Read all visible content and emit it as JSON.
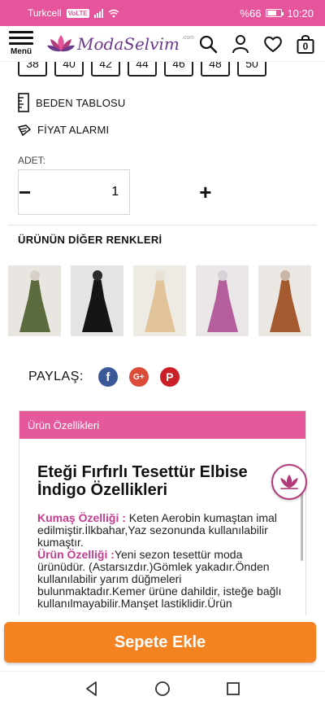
{
  "status_bar": {
    "carrier": "Turkcell",
    "network_badge": "VoLTE",
    "battery_percent": "%66",
    "time": "10:20",
    "color": "#e6559b"
  },
  "header": {
    "menu_label": "Menü",
    "logo_text": "ModaSelvim",
    "logo_sub": ".com",
    "icons": [
      "search-icon",
      "user-icon",
      "heart-icon",
      "cart-icon"
    ],
    "cart_count": "0"
  },
  "sizes": [
    "38",
    "40",
    "42",
    "44",
    "46",
    "48",
    "50"
  ],
  "links": {
    "size_chart": "BEDEN TABLOSU",
    "price_alarm": "FİYAT ALARMI"
  },
  "quantity": {
    "label": "ADET:",
    "minus": "−",
    "value": "1",
    "plus": "+"
  },
  "other_colors": {
    "title": "ÜRÜNÜN DİĞER RENKLERİ",
    "items": [
      {
        "name": "Haki",
        "dress": "#5b6b3e",
        "bg": "#e9e6e1",
        "head": "#d8cfc7"
      },
      {
        "name": "Siyah",
        "dress": "#151515",
        "bg": "#e6e4e2",
        "head": "#2a2a2a"
      },
      {
        "name": "Bej",
        "dress": "#e2c49a",
        "bg": "#eeeae4",
        "head": "#e9e0d4"
      },
      {
        "name": "Lila",
        "dress": "#b45f9c",
        "bg": "#ebe7e9",
        "head": "#d9d1d9"
      },
      {
        "name": "Kiremit",
        "dress": "#a5592e",
        "bg": "#ebe7e3",
        "head": "#c9b6a6"
      }
    ]
  },
  "share": {
    "label": "PAYLAŞ:",
    "facebook": "f",
    "google_plus": "G+",
    "pinterest": "P"
  },
  "features": {
    "header": "Ürün Özellikleri",
    "title": "Eteği Fırfırlı Tesettür Elbise İndigo Özellikleri",
    "fabric_label": "Kumaş Özelliği :",
    "fabric_text": " Keten Aerobin kumaştan imal edilmiştir.İlkbahar,Yaz sezonunda kullanılabilir kumaştır.",
    "product_label": "Ürün Özelliği :",
    "product_text": "Yeni sezon tesettür moda ürünüdür. (Astarsızdır.)Gömlek yakadır.Önden kullanılabilir yarım düğmeleri bulunmaktadır.Kemer ürüne dahildir, isteğe bağlı kullanılmayabilir.Manşet lastiklidir.Ürün",
    "header_color": "#e5599a",
    "label_color": "#c33d91"
  },
  "cta": {
    "add_to_cart": "Sepete Ekle",
    "color": "#f48221"
  },
  "nav_bar": {
    "icons": [
      "back-icon",
      "home-icon",
      "recents-icon"
    ]
  }
}
